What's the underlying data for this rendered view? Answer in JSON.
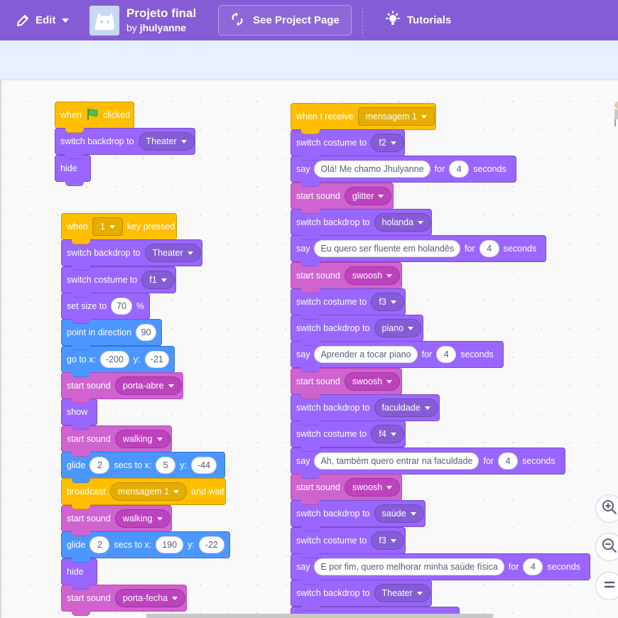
{
  "menubar": {
    "edit_label": "Edit",
    "project_title": "Projeto final",
    "author_prefix": "by",
    "author_name": "jhulyanne",
    "see_project_label": "See Project Page",
    "tutorials_label": "Tutorials",
    "bg_color": "#855cd6"
  },
  "icons": {
    "edit": "pencil-icon",
    "see_project": "remix-arrows-icon",
    "tutorials": "lightbulb-icon",
    "zoom_in": "zoom-in-icon",
    "zoom_out": "zoom-out-icon",
    "zoom_reset": "zoom-reset-icon"
  },
  "colors": {
    "looks": "#9966ff",
    "events": "#ffbf00",
    "motion": "#4c97ff",
    "sound": "#cf63cf"
  },
  "script1": {
    "b1": {
      "when": "when",
      "clicked": "clicked"
    },
    "b2": {
      "label": "switch backdrop to",
      "value": "Theater"
    },
    "b3": {
      "label": "hide"
    }
  },
  "script2": {
    "b1": {
      "when": "when",
      "key": "1",
      "pressed": "key pressed"
    },
    "b2": {
      "label": "switch backdrop to",
      "value": "Theater"
    },
    "b3": {
      "label": "switch costume to",
      "value": "f1"
    },
    "b4": {
      "label": "set size to",
      "value": "70",
      "suffix": "%"
    },
    "b5": {
      "label": "point in direction",
      "value": "90"
    },
    "b6": {
      "label": "go to x:",
      "x": "-200",
      "ylabel": "y:",
      "y": "-21"
    },
    "b7": {
      "label": "start sound",
      "value": "porta-abre"
    },
    "b8": {
      "label": "show"
    },
    "b9": {
      "label": "start sound",
      "value": "walking"
    },
    "b10": {
      "label": "glide",
      "secs": "2",
      "mid": "secs to x:",
      "x": "5",
      "ylabel": "y:",
      "y": "-44"
    },
    "b11": {
      "label": "broadcast",
      "value": "mensagem 1",
      "suffix": "and wait"
    },
    "b12": {
      "label": "start sound",
      "value": "walking"
    },
    "b13": {
      "label": "glide",
      "secs": "2",
      "mid": "secs to x:",
      "x": "190",
      "ylabel": "y:",
      "y": "-22"
    },
    "b14": {
      "label": "hide"
    },
    "b15": {
      "label": "start sound",
      "value": "porta-fecha"
    }
  },
  "script3": {
    "b1": {
      "label": "when I receive",
      "value": "mensagem 1"
    },
    "b2": {
      "label": "switch costume to",
      "value": "f2"
    },
    "b3": {
      "say": "say",
      "text": "Olá! Me chamo Jhulyanne",
      "for": "for",
      "secs": "4",
      "seconds": "seconds"
    },
    "b4": {
      "label": "start sound",
      "value": "glitter"
    },
    "b5": {
      "label": "switch backdrop to",
      "value": "holanda"
    },
    "b6": {
      "say": "say",
      "text": "Eu quero ser fluente em holandês",
      "for": "for",
      "secs": "4",
      "seconds": "seconds"
    },
    "b7": {
      "label": "start sound",
      "value": "swoosh"
    },
    "b8": {
      "label": "switch costume to",
      "value": "f3"
    },
    "b9": {
      "label": "switch backdrop to",
      "value": "piano"
    },
    "b10": {
      "say": "say",
      "text": "Aprender a tocar piano",
      "for": "for",
      "secs": "4",
      "seconds": "seconds"
    },
    "b11": {
      "label": "start sound",
      "value": "swoosh"
    },
    "b12": {
      "label": "switch backdrop to",
      "value": "faculdade"
    },
    "b13": {
      "label": "switch costume to",
      "value": "f4"
    },
    "b14": {
      "say": "say",
      "text": "Ah, também quero entrar na faculdade",
      "for": "for",
      "secs": "4",
      "seconds": "seconds"
    },
    "b15": {
      "label": "start sound",
      "value": "swoosh"
    },
    "b16": {
      "label": "switch backdrop to",
      "value": "saúde"
    },
    "b17": {
      "label": "switch costume to",
      "value": "f3"
    },
    "b18": {
      "say": "say",
      "text": "E por fim, quero melhorar minha saúde física",
      "for": "for",
      "secs": "4",
      "seconds": "seconds"
    },
    "b19": {
      "label": "switch backdrop to",
      "value": "Theater"
    }
  }
}
